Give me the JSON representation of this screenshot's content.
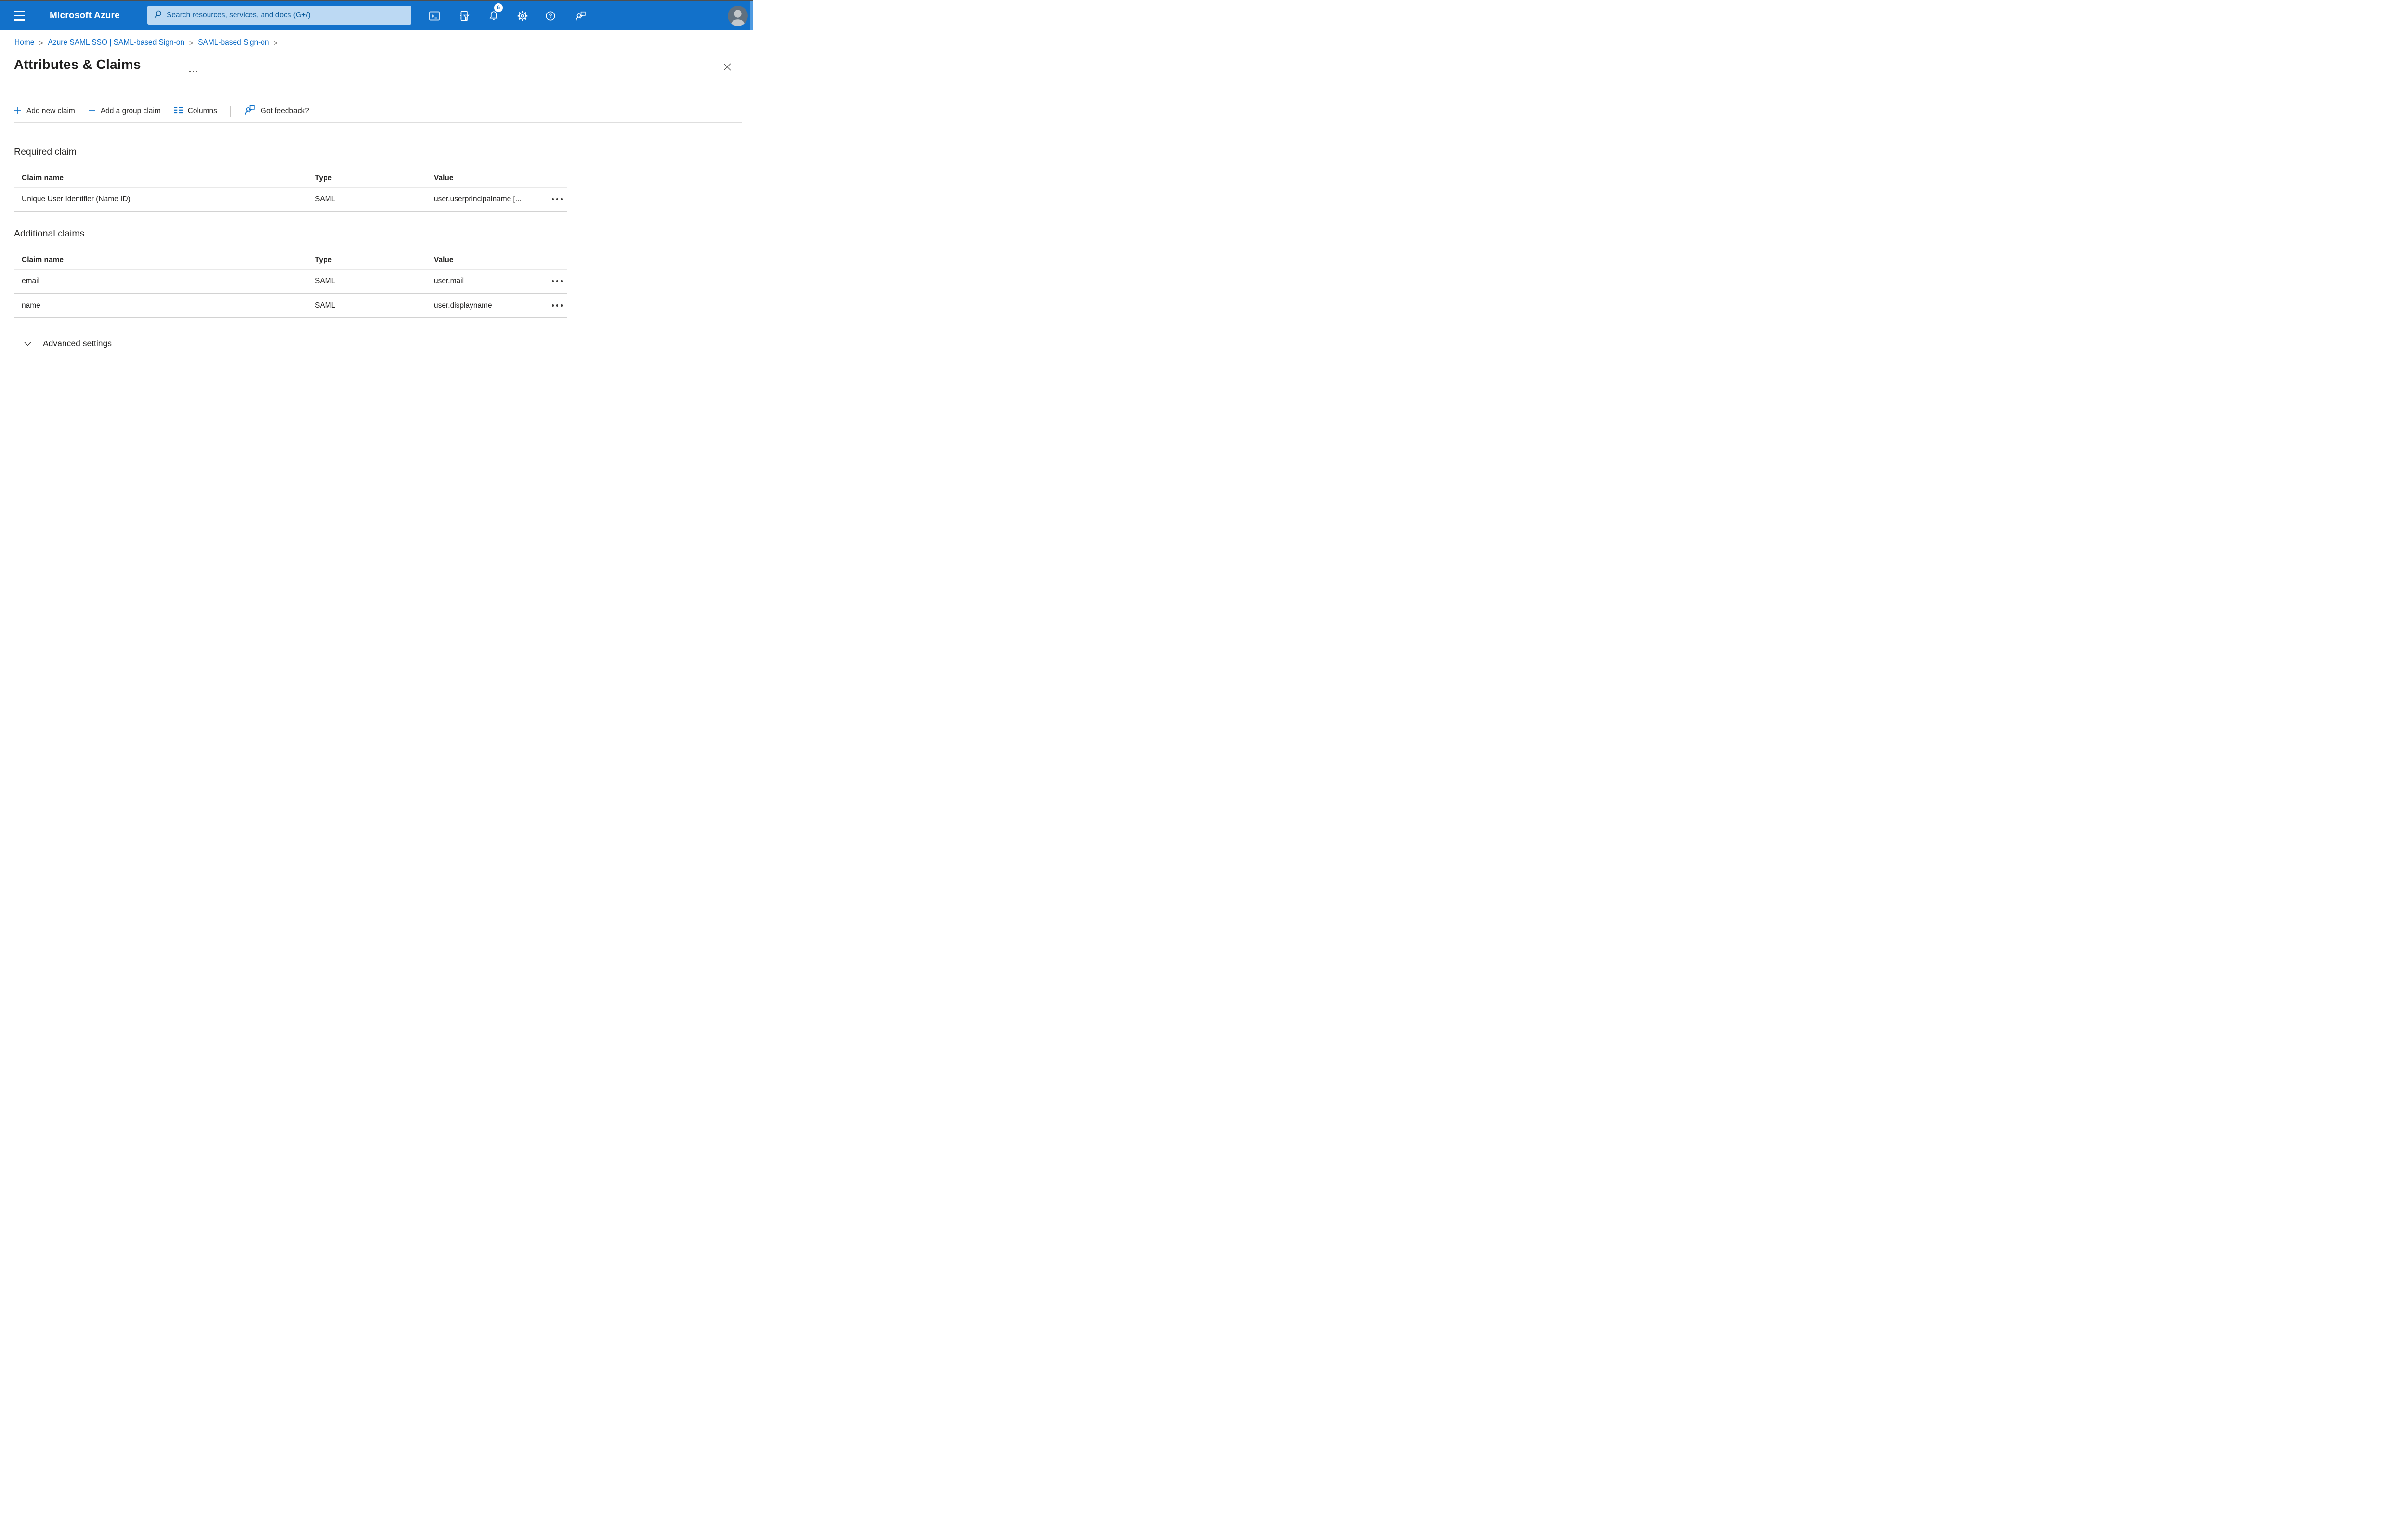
{
  "header": {
    "brand": "Microsoft Azure",
    "search_placeholder": "Search resources, services, and docs (G+/)",
    "notifications_badge": "6"
  },
  "breadcrumb": {
    "separator": ">",
    "items": [
      {
        "label": "Home"
      },
      {
        "label": "Azure SAML SSO | SAML-based Sign-on"
      },
      {
        "label": "SAML-based Sign-on"
      }
    ]
  },
  "page": {
    "title": "Attributes & Claims"
  },
  "toolbar": {
    "add_new_label": "Add new claim",
    "add_group_label": "Add a group claim",
    "columns_label": "Columns",
    "feedback_label": "Got feedback?"
  },
  "required_claim": {
    "heading": "Required claim",
    "columns": {
      "name": "Claim name",
      "type": "Type",
      "value": "Value"
    },
    "rows": [
      {
        "name": "Unique User Identifier (Name ID)",
        "type": "SAML",
        "value": "user.userprincipalname [..."
      }
    ]
  },
  "additional_claims": {
    "heading": "Additional claims",
    "columns": {
      "name": "Claim name",
      "type": "Type",
      "value": "Value"
    },
    "rows": [
      {
        "name": "email",
        "type": "SAML",
        "value": "user.mail"
      },
      {
        "name": "name",
        "type": "SAML",
        "value": "user.displayname"
      }
    ]
  },
  "advanced": {
    "label": "Advanced settings"
  },
  "icons": {
    "hamburger": "menu",
    "search": "magnifier",
    "cloud_shell": "terminal",
    "filter": "page-with-funnel",
    "bell": "notifications",
    "gear": "settings",
    "help": "question-circle",
    "feedback": "person-with-chat-bubble",
    "avatar": "person-silhouette",
    "close": "x",
    "plus": "+",
    "columns": "two-column-list",
    "chevron_down": "v",
    "title_overflow": "ellipsis",
    "row_menu": "horizontal-dots"
  },
  "colors": {
    "header_bg": "#1271ca",
    "accent": "#0d70c8",
    "search_bg": "#bcd9f3",
    "search_text": "#0d5c9c",
    "link": "#0d6cc6",
    "divider_light": "#e9e9e9",
    "divider_mid": "#d2d2d2",
    "text": "#252423"
  }
}
